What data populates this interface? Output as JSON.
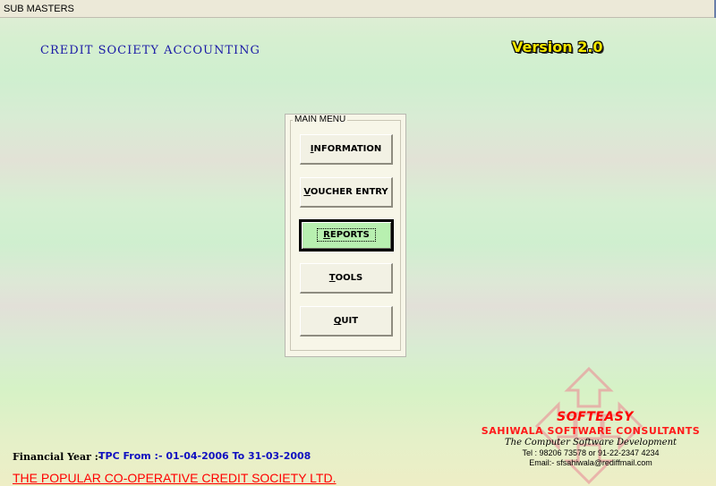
{
  "window": {
    "title": "SUB MASTERS"
  },
  "header": {
    "app_name": "CREDIT SOCIETY ACCOUNTING",
    "version": "Version 2.0"
  },
  "main_menu": {
    "legend": "MAIN MENU",
    "buttons": [
      {
        "label": "INFORMATION",
        "accel": "I"
      },
      {
        "label": "VOUCHER ENTRY",
        "accel": "V"
      },
      {
        "label": "REPORTS",
        "accel": "R",
        "active": true
      },
      {
        "label": "TOOLS",
        "accel": "T"
      },
      {
        "label": "QUIT",
        "accel": "Q"
      }
    ]
  },
  "vendor": {
    "brand": "SOFTEASY",
    "company": "SAHIWALA SOFTWARE CONSULTANTS",
    "tagline": "The Computer Software Development",
    "tel": "Tel : 98206 73578 or 91-22-2347 4234",
    "email": "Email:- sfsahiwala@rediffmail.com"
  },
  "footer": {
    "financial_year_label": "Financial Year :-",
    "financial_year_value": "TPC From :- 01-04-2006 To 31-03-2008",
    "society_name": "THE POPULAR CO-OPERATIVE CREDIT SOCIETY LTD."
  },
  "colors": {
    "active_button": "#b8f0b0",
    "heading_blue": "#1a1aa6",
    "vendor_red": "#ff0000",
    "version_yellow": "#f2e600"
  }
}
